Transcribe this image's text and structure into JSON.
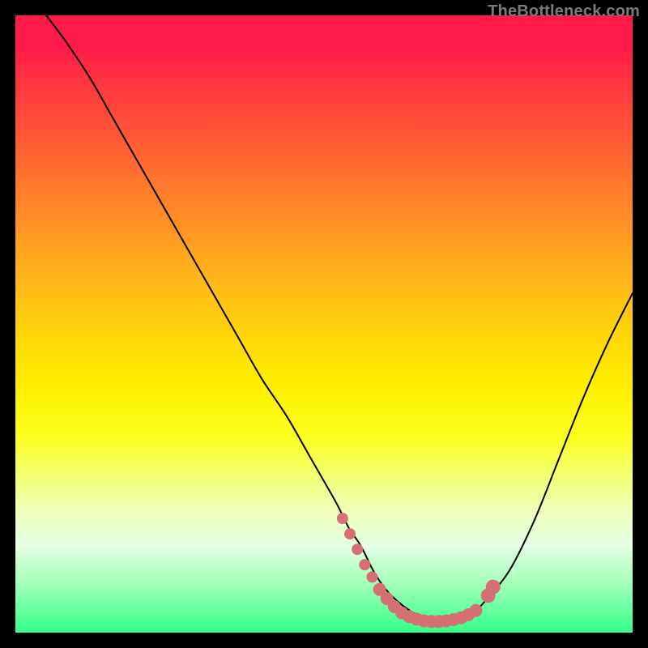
{
  "watermark": "TheBottleneck.com",
  "colors": {
    "background": "#000000",
    "curve": "#000000",
    "marker": "#d47074",
    "watermark": "#7a7a7a"
  },
  "chart_data": {
    "type": "line",
    "title": "",
    "xlabel": "",
    "ylabel": "",
    "xlim": [
      0,
      100
    ],
    "ylim": [
      0,
      100
    ],
    "series": [
      {
        "name": "bottleneck-curve",
        "x": [
          5,
          8,
          12,
          16,
          20,
          24,
          28,
          32,
          36,
          40,
          44,
          48,
          52,
          54,
          56,
          58,
          60,
          62,
          64,
          66,
          68,
          70,
          72,
          74,
          76,
          80,
          84,
          88,
          92,
          96,
          100
        ],
        "y": [
          100,
          96,
          90,
          83,
          76,
          69,
          62,
          55,
          48,
          41,
          35,
          28,
          21,
          17,
          14,
          10,
          7,
          5,
          3.5,
          2.5,
          2,
          2,
          2.3,
          3,
          5,
          10,
          18,
          28,
          38,
          47,
          55
        ]
      }
    ],
    "markers": {
      "name": "highlighted-bottleneck-region",
      "color": "#d47074",
      "points": [
        {
          "x": 53.0,
          "y": 18.5,
          "r": 7
        },
        {
          "x": 54.2,
          "y": 16.0,
          "r": 7
        },
        {
          "x": 55.4,
          "y": 13.5,
          "r": 7
        },
        {
          "x": 56.6,
          "y": 11.0,
          "r": 7
        },
        {
          "x": 57.8,
          "y": 9.0,
          "r": 7
        },
        {
          "x": 59.0,
          "y": 7.0,
          "r": 8
        },
        {
          "x": 60.2,
          "y": 5.5,
          "r": 8
        },
        {
          "x": 61.4,
          "y": 4.2,
          "r": 8
        },
        {
          "x": 62.6,
          "y": 3.2,
          "r": 8
        },
        {
          "x": 63.8,
          "y": 2.6,
          "r": 8
        },
        {
          "x": 65.0,
          "y": 2.2,
          "r": 8
        },
        {
          "x": 66.2,
          "y": 1.9,
          "r": 8
        },
        {
          "x": 67.4,
          "y": 1.8,
          "r": 8
        },
        {
          "x": 68.6,
          "y": 1.8,
          "r": 8
        },
        {
          "x": 69.8,
          "y": 1.9,
          "r": 8
        },
        {
          "x": 71.0,
          "y": 2.1,
          "r": 8
        },
        {
          "x": 72.2,
          "y": 2.4,
          "r": 8
        },
        {
          "x": 73.4,
          "y": 2.9,
          "r": 8
        },
        {
          "x": 74.6,
          "y": 3.6,
          "r": 8
        },
        {
          "x": 76.6,
          "y": 6.0,
          "r": 9
        },
        {
          "x": 77.4,
          "y": 7.4,
          "r": 9
        }
      ]
    },
    "gradient_stops": [
      {
        "pos": 0.0,
        "color": "#ff1a4a"
      },
      {
        "pos": 0.05,
        "color": "#ff1a4a"
      },
      {
        "pos": 0.12,
        "color": "#ff3a3f"
      },
      {
        "pos": 0.2,
        "color": "#ff5a35"
      },
      {
        "pos": 0.28,
        "color": "#ff7a2c"
      },
      {
        "pos": 0.36,
        "color": "#ff9a22"
      },
      {
        "pos": 0.44,
        "color": "#ffba17"
      },
      {
        "pos": 0.52,
        "color": "#ffd60a"
      },
      {
        "pos": 0.6,
        "color": "#ffee00"
      },
      {
        "pos": 0.68,
        "color": "#fbff1e"
      },
      {
        "pos": 0.74,
        "color": "#f5ff6a"
      },
      {
        "pos": 0.8,
        "color": "#eeffb6"
      },
      {
        "pos": 0.86,
        "color": "#e4ffe4"
      },
      {
        "pos": 0.92,
        "color": "#a3ffb8"
      },
      {
        "pos": 1.0,
        "color": "#34ff8a"
      }
    ]
  }
}
